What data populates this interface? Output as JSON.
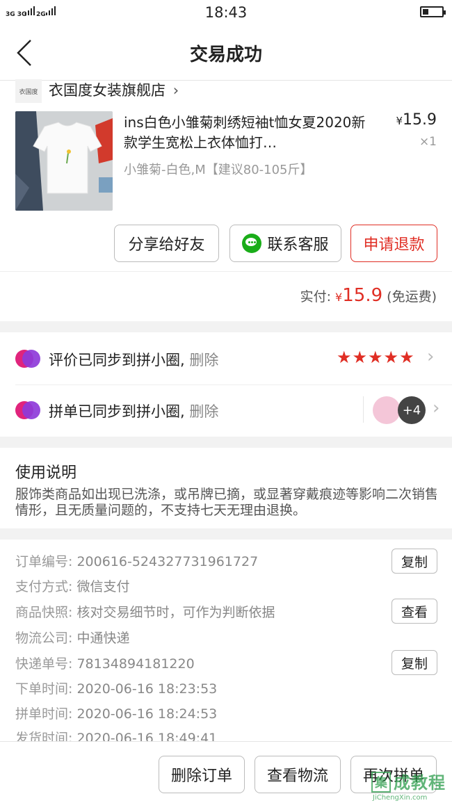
{
  "status_bar": {
    "signal_1": "3G 3G",
    "signal_2": "2G",
    "time": "18:43"
  },
  "header": {
    "title": "交易成功"
  },
  "store": {
    "logo_text": "衣国度",
    "name": "衣国度女装旗舰店"
  },
  "product": {
    "title": "ins白色小雏菊刺绣短袖t恤女夏2020新款学生宽松上衣体恤打…",
    "spec": "小雏菊-白色,M【建议80-105斤】",
    "currency": "¥",
    "price": "15.9",
    "quantity": "×1"
  },
  "actions": {
    "share": "分享给好友",
    "contact": "联系客服",
    "refund": "申请退款"
  },
  "payment": {
    "label": "实付:",
    "currency": "¥",
    "amount": "15.9",
    "note": "(免运费)"
  },
  "sync": {
    "review_text": "评价已同步到拼小圈,",
    "order_text": "拼单已同步到拼小圈,",
    "delete_label": "删除",
    "rating_stars": 5,
    "extra_count": "+4"
  },
  "notice": {
    "title": "使用说明",
    "body": "服饰类商品如出现已洗涤，或吊牌已摘，或显著穿戴痕迹等影响二次销售情形，且无质量问题的，不支持七天无理由退换。"
  },
  "order_info": {
    "order_no_label": "订单编号:",
    "order_no": "200616-524327731961727",
    "pay_method_label": "支付方式:",
    "pay_method": "微信支付",
    "snapshot_label": "商品快照:",
    "snapshot": "核对交易细节时，可作为判断依据",
    "courier_label": "物流公司:",
    "courier": "中通快递",
    "tracking_label": "快递单号:",
    "tracking_no": "78134894181220",
    "order_time_label": "下单时间:",
    "order_time": "2020-06-16 18:23:53",
    "group_time_label": "拼单时间:",
    "group_time": "2020-06-16 18:24:53",
    "ship_time_label": "发货时间:",
    "ship_time": "2020-06-16 18:49:41",
    "copy_label": "复制",
    "view_label": "查看"
  },
  "bottom": {
    "delete_order": "删除订单",
    "view_logistics": "查看物流",
    "rebuy": "再次拼单"
  },
  "watermark": {
    "icon_text": "集",
    "text": "成教程",
    "url": "JiChengXin.com"
  },
  "colors": {
    "accent": "#e02e24",
    "wechat": "#1aad19",
    "divider_bg": "#f2f2f2"
  }
}
